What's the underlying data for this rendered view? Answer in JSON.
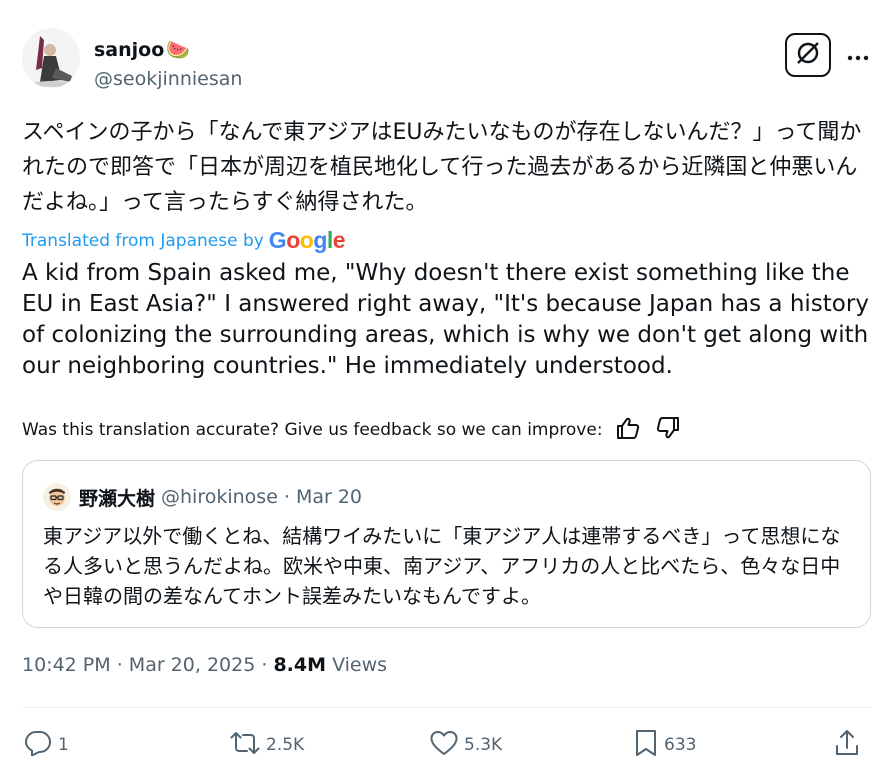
{
  "author": {
    "name": "sanjoo",
    "emoji": "🍉",
    "handle": "@seokjinniesan"
  },
  "post": {
    "text_ja": "スペインの子から「なんで東アジアはEUみたいなものが存在しないんだ？」って聞かれたので即答で「日本が周辺を植民地化して行った過去があるから近隣国と仲悪いんだよね。」って言ったらすぐ納得された。",
    "translated_label": "Translated from Japanese by",
    "translated_by": "Google",
    "text_en": "A kid from Spain asked me, \"Why doesn't there exist something like the EU in East Asia?\" I answered right away, \"It's because Japan has a history of colonizing the surrounding areas, which is why we don't get along with our neighboring countries.\" He immediately understood.",
    "feedback": "Was this translation accurate? Give us feedback so we can improve:"
  },
  "quote": {
    "name": "野瀬大樹",
    "handle": "@hirokinose",
    "sep": "·",
    "date": "Mar 20",
    "text": "東アジア以外で働くとね、結構ワイみたいに「東アジア人は連帯するべき」って思想になる人多いと思うんだよね。欧米や中東、南アジア、アフリカの人と比べたら、色々な日中や日韓の間の差なんてホント誤差みたいなもんですよ。"
  },
  "meta": {
    "time": "10:42 PM",
    "sep": "·",
    "date": "Mar 20, 2025",
    "sep2": "·",
    "views_count": "8.4M",
    "views_label": "Views"
  },
  "actions": {
    "replies": "1",
    "reposts": "2.5K",
    "likes": "5.3K",
    "bookmarks": "633"
  },
  "colors": {
    "link": "#1d9bf0",
    "secondary_text": "#536471",
    "primary_text": "#0f1419",
    "border": "#cfd9de"
  },
  "icons": [
    "grok-icon",
    "more-icon",
    "thumbs-up-icon",
    "thumbs-down-icon",
    "reply-icon",
    "repost-icon",
    "like-icon",
    "bookmark-icon",
    "share-icon"
  ]
}
